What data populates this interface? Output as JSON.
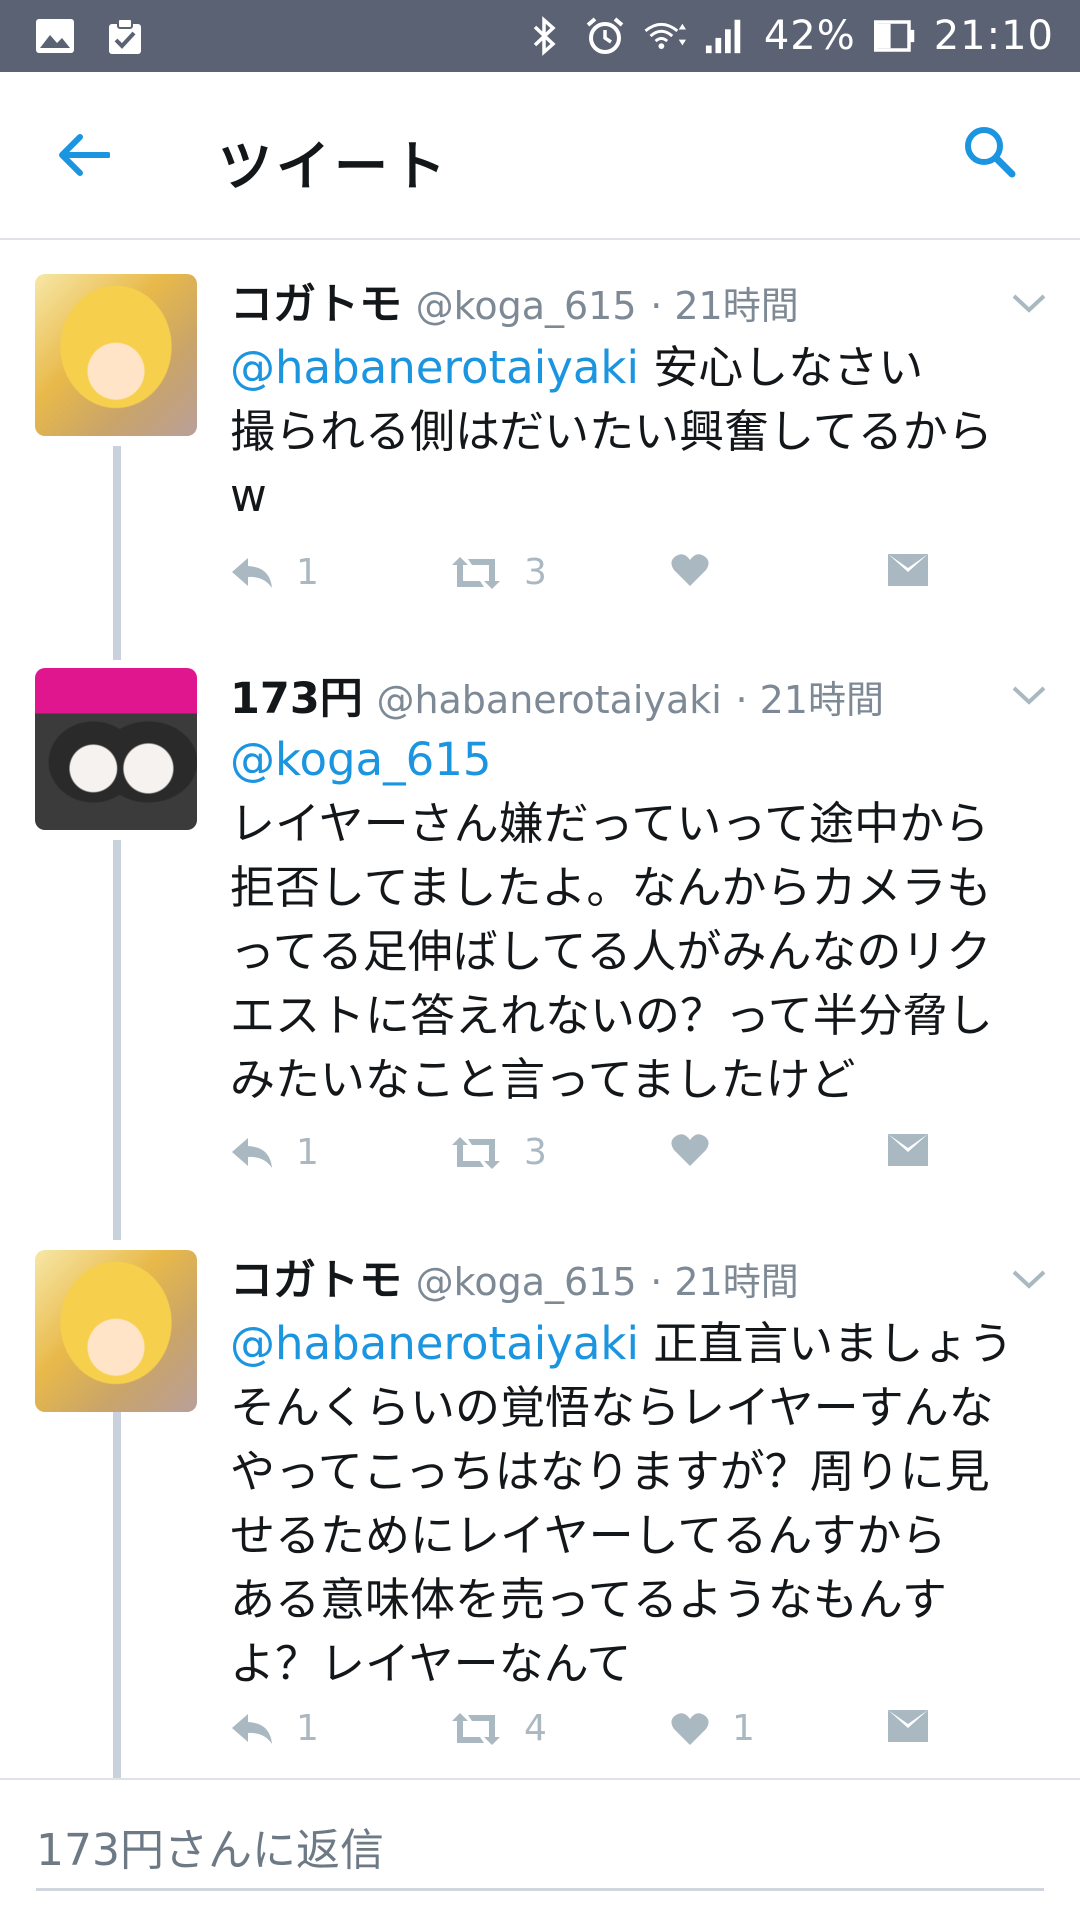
{
  "status_bar": {
    "battery": "42%",
    "time": "21:10",
    "left_icons": [
      "image-icon",
      "clipboard-check-icon"
    ],
    "right_icons": [
      "bluetooth-icon",
      "alarm-icon",
      "wifi-icon",
      "signal-icon",
      "battery-icon"
    ]
  },
  "header": {
    "title": "ツイート",
    "back_icon": "arrow-left-icon",
    "search_icon": "search-icon"
  },
  "colors": {
    "accent": "#1b95e0",
    "action_gray": "#aab8c2",
    "status_bar": "#5b6273",
    "thread_line": "#c9d2dc"
  },
  "tweets": [
    {
      "name": "コガトモ",
      "handle": "@koga_615",
      "time": "· 21時間",
      "mention": "@habanerotaiyaki",
      "lines": [
        "安心しなさい",
        "撮られる側はだいたい興奮してるから",
        "w"
      ],
      "reply_count": "1",
      "retweet_count": "3",
      "like_count": ""
    },
    {
      "name": "173円",
      "handle": "@habanerotaiyaki",
      "time": "· 21時間",
      "mention": "@koga_615",
      "lines": [
        "レイヤーさん嫌だっていって途中から",
        "拒否してましたよ。なんからカメラも",
        "ってる足伸ばしてる人がみんなのリク",
        "エストに答えれないの？って半分脅し",
        "みたいなこと言ってましたけど"
      ],
      "reply_count": "1",
      "retweet_count": "3",
      "like_count": ""
    },
    {
      "name": "コガトモ",
      "handle": "@koga_615",
      "time": "· 21時間",
      "mention": "@habanerotaiyaki",
      "lines": [
        "正直言いましょう",
        "そんくらいの覚悟ならレイヤーすんな",
        "やってこっちはなりますが？周りに見",
        "せるためにレイヤーしてるんすから",
        "ある意味体を売ってるようなもんす",
        "よ？レイヤーなんて"
      ],
      "reply_count": "1",
      "retweet_count": "4",
      "like_count": "1"
    }
  ],
  "reply_bar": {
    "placeholder": "173円さんに返信"
  }
}
